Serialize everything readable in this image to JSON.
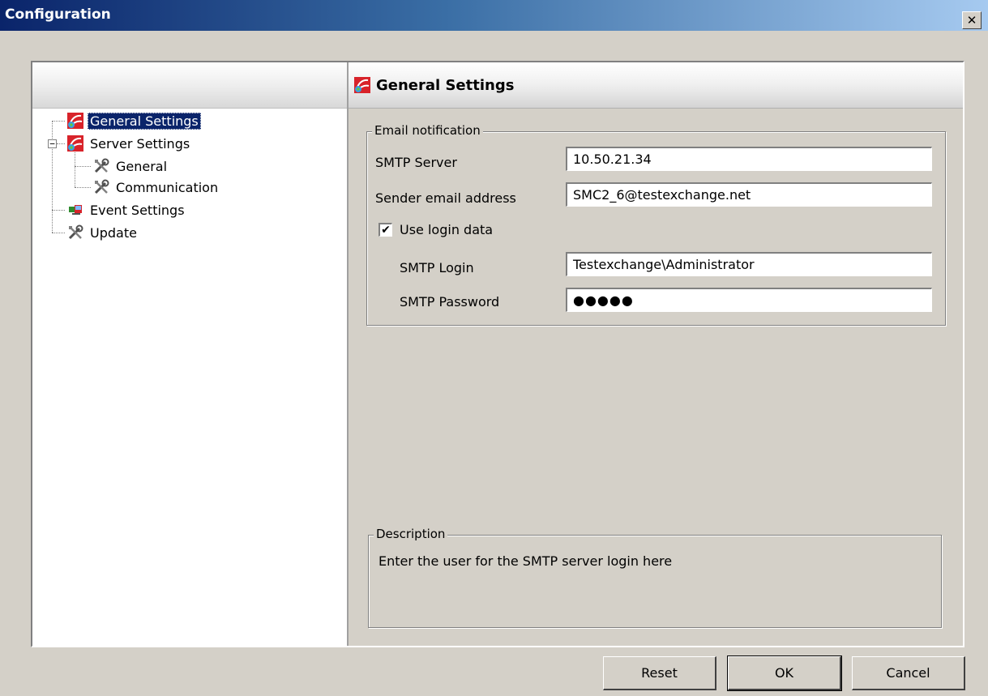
{
  "window": {
    "title": "Configuration",
    "close_glyph": "✕"
  },
  "tree": {
    "items": [
      {
        "label": "General Settings",
        "icon": "smc-app-icon"
      },
      {
        "label": "Server Settings",
        "icon": "smc-app-icon",
        "expander": "−"
      },
      {
        "label": "General",
        "icon": "tools-icon"
      },
      {
        "label": "Communication",
        "icon": "tools-icon"
      },
      {
        "label": "Event Settings",
        "icon": "event-icon"
      },
      {
        "label": "Update",
        "icon": "tools-icon"
      }
    ],
    "selected": "General Settings"
  },
  "content": {
    "title": "General Settings",
    "email_group": {
      "legend": "Email notification",
      "smtp_server_label": "SMTP Server",
      "smtp_server_value": "10.50.21.34",
      "sender_label": "Sender email address",
      "sender_value": "SMC2_6@testexchange.net",
      "use_login_label": "Use login data",
      "use_login_checked": true,
      "check_glyph": "✔",
      "smtp_login_label": "SMTP Login",
      "smtp_login_value": "Testexchange\\Administrator",
      "smtp_password_label": "SMTP Password",
      "smtp_password_value": "●●●●●"
    },
    "description_group": {
      "legend": "Description",
      "text": "Enter the user for the SMTP server login here"
    }
  },
  "buttons": {
    "reset": "Reset",
    "ok": "OK",
    "cancel": "Cancel"
  },
  "colors": {
    "selection": "#0a246a",
    "titlebar_start": "#0a246a",
    "titlebar_end": "#a6caf0",
    "face": "#d4d0c8"
  }
}
